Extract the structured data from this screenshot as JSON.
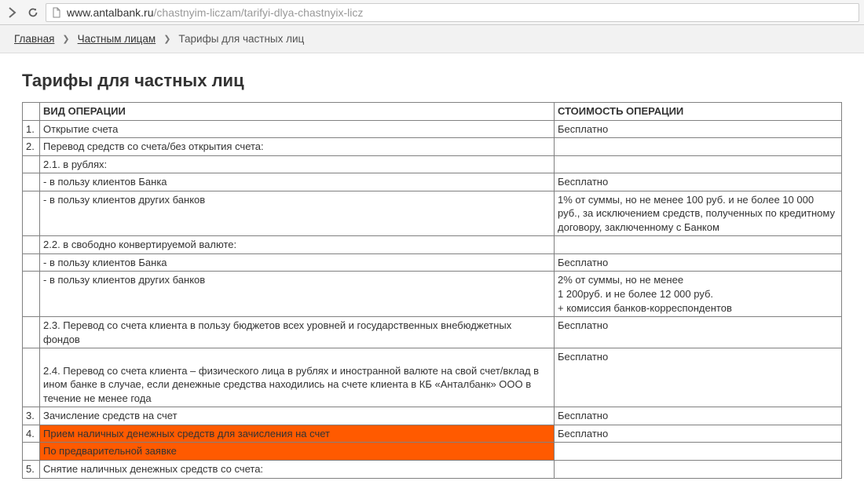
{
  "browser": {
    "url_host": "www.antalbank.ru",
    "url_path": "/chastnyim-liczam/tarifyi-dlya-chastnyix-licz"
  },
  "breadcrumb": {
    "home": "Главная",
    "section": "Частным лицам",
    "current": "Тарифы для частных лиц"
  },
  "page": {
    "title": "Тарифы для частных лиц"
  },
  "table": {
    "head": {
      "num": "",
      "op": "ВИД ОПЕРАЦИИ",
      "val": "СТОИМОСТЬ ОПЕРАЦИИ"
    },
    "rows": [
      {
        "num": "1.",
        "op": "Открытие счета",
        "val": "Бесплатно"
      },
      {
        "num": "2.",
        "op": "Перевод средств со счета/без открытия счета:",
        "val": ""
      },
      {
        "num": "",
        "op": "2.1. в рублях:",
        "val": ""
      },
      {
        "num": "",
        "op": "- в пользу клиентов Банка",
        "val": "Бесплатно"
      },
      {
        "num": "",
        "op": "- в пользу клиентов других банков",
        "val": "1% от суммы, но не менее 100 руб. и не более 10 000 руб., за исключением средств, полученных по кредитному договору, заключенному с Банком"
      },
      {
        "num": "",
        "op": "2.2. в свободно конвертируемой валюте:",
        "val": ""
      },
      {
        "num": "",
        "op": "- в пользу клиентов Банка",
        "val": "Бесплатно"
      },
      {
        "num": "",
        "op": "- в пользу клиентов других банков",
        "val": "2% от суммы, но не менее\n1 200руб. и не более 12 000 руб.\n+ комиссия банков-корреспондентов"
      },
      {
        "num": "",
        "op": "2.3. Перевод со счета клиента в пользу бюджетов всех уровней и государственных внебюджетных фондов",
        "val": "Бесплатно"
      },
      {
        "num": "",
        "op": "\n2.4. Перевод со счета клиента – физического лица в рублях и иностранной валюте на свой счет/вклад в ином банке в случае, если денежные средства находились на счете клиента в КБ «Анталбанк» ООО в течение не менее года",
        "val": "Бесплатно"
      },
      {
        "num": "3.",
        "op": "Зачисление средств на счет",
        "val": "Бесплатно"
      },
      {
        "num": "4.",
        "op": "Прием наличных денежных средств для зачисления на счет",
        "val": "Бесплатно",
        "hlOp": true
      },
      {
        "num": "",
        "op": "По предварительной заявке",
        "val": "",
        "hlOp": true
      },
      {
        "num": "5.",
        "op": "Снятие наличных денежных средств со счета:",
        "val": ""
      }
    ]
  }
}
